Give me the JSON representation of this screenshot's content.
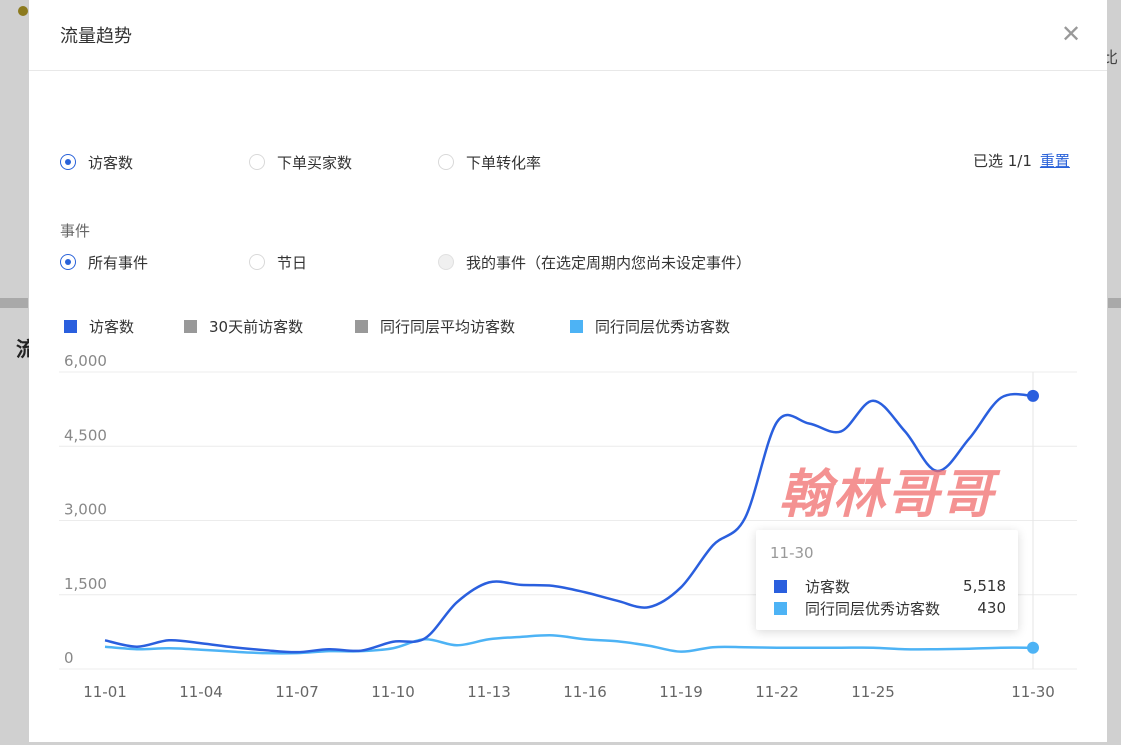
{
  "background": {
    "fragment_right": "比"
  },
  "dialog": {
    "title": "流量趋势",
    "close_glyph": "✕"
  },
  "metrics": {
    "options": [
      "访客数",
      "下单买家数",
      "下单转化率"
    ],
    "selected_index": 0,
    "selected_text": "已选 1/1",
    "reset_label": "重置"
  },
  "events": {
    "label": "事件",
    "options": [
      "所有事件",
      "节日",
      "我的事件（在选定周期内您尚未设定事件）"
    ],
    "selected_index": 0,
    "disabled_index": 2
  },
  "legend": [
    {
      "name": "访客数",
      "color": "#2a5fde"
    },
    {
      "name": "30天前访客数",
      "color": "#999999"
    },
    {
      "name": "同行同层平均访客数",
      "color": "#999999"
    },
    {
      "name": "同行同层优秀访客数",
      "color": "#4db3f5"
    }
  ],
  "chart_data": {
    "type": "line",
    "x": [
      "11-01",
      "11-02",
      "11-03",
      "11-04",
      "11-05",
      "11-06",
      "11-07",
      "11-08",
      "11-09",
      "11-10",
      "11-11",
      "11-12",
      "11-13",
      "11-14",
      "11-15",
      "11-16",
      "11-17",
      "11-18",
      "11-19",
      "11-20",
      "11-21",
      "11-22",
      "11-23",
      "11-24",
      "11-25",
      "11-26",
      "11-27",
      "11-28",
      "11-29",
      "11-30"
    ],
    "x_tick_labels": [
      "11-01",
      "11-04",
      "11-07",
      "11-10",
      "11-13",
      "11-16",
      "11-19",
      "11-22",
      "11-25",
      "11-30"
    ],
    "y_tick_labels": [
      "6,000",
      "4,500",
      "3,000",
      "1,500",
      "0"
    ],
    "ylim": [
      0,
      6000
    ],
    "series": [
      {
        "name": "访客数",
        "color": "#2a5fde",
        "values": [
          580,
          450,
          580,
          520,
          440,
          380,
          340,
          400,
          370,
          550,
          620,
          1350,
          1750,
          1700,
          1680,
          1550,
          1380,
          1250,
          1650,
          2500,
          3050,
          4990,
          4960,
          4800,
          5420,
          4800,
          4000,
          4650,
          5480,
          5518
        ]
      },
      {
        "name": "同行同层优秀访客数",
        "color": "#4db3f5",
        "values": [
          450,
          400,
          420,
          390,
          350,
          320,
          320,
          360,
          360,
          420,
          600,
          480,
          600,
          650,
          680,
          600,
          560,
          470,
          350,
          440,
          440,
          430,
          430,
          430,
          430,
          400,
          400,
          410,
          430,
          430
        ]
      }
    ],
    "tooltip": {
      "date": "11-30",
      "rows": [
        {
          "name": "访客数",
          "value": "5,518",
          "color": "#2a5fde"
        },
        {
          "name": "同行同层优秀访客数",
          "value": "430",
          "color": "#4db3f5"
        }
      ]
    }
  },
  "watermark": "翰林哥哥"
}
